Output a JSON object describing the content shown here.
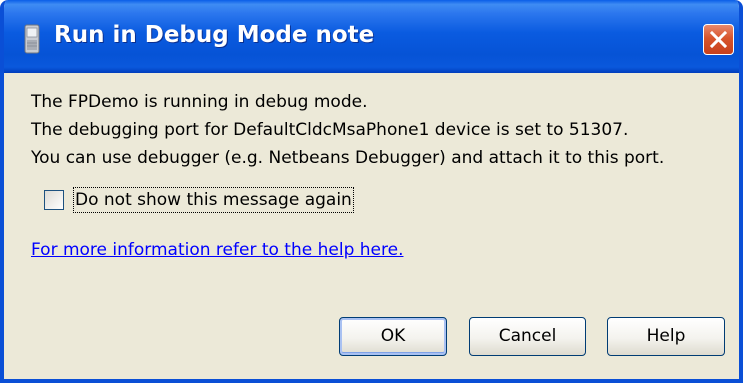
{
  "window": {
    "title": "Run in Debug Mode note",
    "icon": "phone-icon",
    "close_icon": "close-icon"
  },
  "message": {
    "lines": [
      "The FPDemo is running in debug mode.",
      "The debugging port for DefaultCldcMsaPhone1 device is set to 51307.",
      "You can use debugger (e.g. Netbeans Debugger) and attach it to this port."
    ]
  },
  "checkbox": {
    "label": "Do not show this message again",
    "checked": false
  },
  "help_link": {
    "text": "For more information refer to the help here."
  },
  "buttons": {
    "ok": "OK",
    "cancel": "Cancel",
    "help": "Help"
  },
  "colors": {
    "titlebar": "#0a5be0",
    "window_bg": "#ece9d8",
    "close_button": "#d8552c",
    "link": "#0000ff"
  }
}
